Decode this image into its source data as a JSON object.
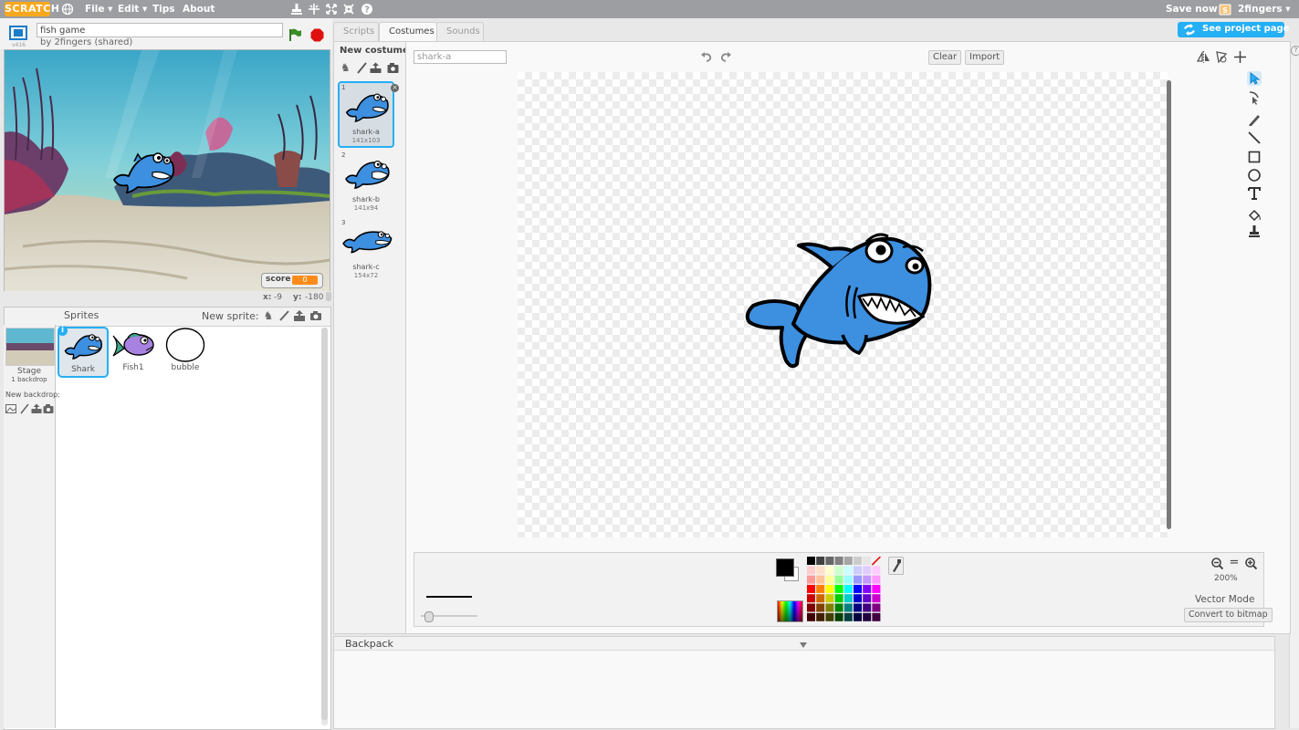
{
  "menubar": {
    "logo": "SCRATCH",
    "menus": [
      "File ▾",
      "Edit ▾",
      "Tips",
      "About"
    ],
    "save_now": "Save now",
    "user": "2fingers ▾"
  },
  "project": {
    "title_value": "fish game",
    "byline": "by 2fingers (shared)",
    "version": "v416"
  },
  "stage": {
    "score_label": "score",
    "score_value": "0",
    "x_label": "x:",
    "x_value": "-9",
    "y_label": "y:",
    "y_value": "-180"
  },
  "sprites_pane": {
    "title": "Sprites",
    "new_sprite": "New sprite:",
    "stage_label": "Stage",
    "stage_sub": "1 backdrop",
    "new_backdrop": "New backdrop:",
    "sprites": [
      {
        "name": "Shark"
      },
      {
        "name": "Fish1"
      },
      {
        "name": "bubble"
      }
    ]
  },
  "tabs": [
    "Scripts",
    "Costumes",
    "Sounds"
  ],
  "see_project_page": "See project page",
  "costumes": {
    "new_costume": "New costume:",
    "items": [
      {
        "num": "1",
        "name": "shark-a",
        "size": "141x103"
      },
      {
        "num": "2",
        "name": "shark-b",
        "size": "141x94"
      },
      {
        "num": "3",
        "name": "shark-c",
        "size": "154x72"
      }
    ]
  },
  "editor": {
    "costume_name": "shark-a",
    "clear": "Clear",
    "import": "Import",
    "zoom": "200%",
    "mode": "Vector Mode",
    "convert": "Convert to bitmap"
  },
  "backpack": {
    "title": "Backpack"
  },
  "colors": {
    "accent": "#25aff4",
    "menubar": "#9c9ea2",
    "shark_blue": "#3d8fe0",
    "score_orange": "#ff8c1a"
  }
}
